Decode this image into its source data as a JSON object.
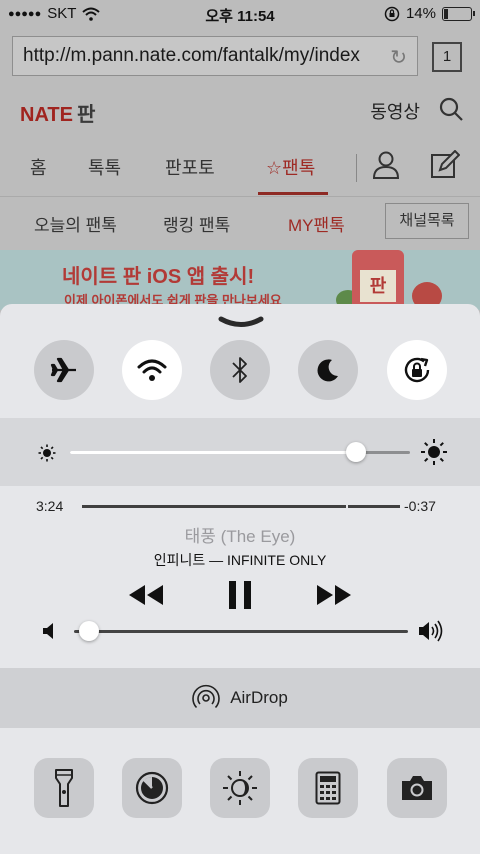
{
  "status_bar": {
    "signal_dots": "●●●●●",
    "carrier": "SKT",
    "time": "오후 11:54",
    "battery_percent": "14%",
    "battery_level": 0.14
  },
  "browser": {
    "url": "http://m.pann.nate.com/fantalk/my/index",
    "tab_count": "1"
  },
  "site": {
    "logo": "NATE",
    "logo_suffix": "판",
    "video_link": "동영상",
    "nav_main": [
      "홈",
      "톡톡",
      "판포토",
      "☆팬톡"
    ],
    "nav_sub": [
      "오늘의 팬톡",
      "랭킹 팬톡",
      "MY팬톡"
    ],
    "channel_button": "채널목록",
    "banner_title": "네이트 판 iOS 앱 출시!",
    "banner_subtitle": "이제 아이폰에서도 쉽게 판을 만나보세요",
    "banner_phone_text": "판"
  },
  "control_center": {
    "toggles": [
      {
        "name": "airplane-mode",
        "icon": "airplane-icon",
        "on": false
      },
      {
        "name": "wifi",
        "icon": "wifi-icon",
        "on": true
      },
      {
        "name": "bluetooth",
        "icon": "bluetooth-icon",
        "on": false
      },
      {
        "name": "do-not-disturb",
        "icon": "moon-icon",
        "on": false
      },
      {
        "name": "rotation-lock",
        "icon": "rotation-lock-icon",
        "on": true
      }
    ],
    "brightness": 0.84,
    "music": {
      "elapsed": "3:24",
      "remaining": "-0:37",
      "progress": 0.83,
      "title": "태풍 (The Eye)",
      "artist_album": "인피니트 — INFINITE ONLY",
      "volume": 0.02
    },
    "airdrop_label": "AirDrop",
    "shortcuts": [
      "flashlight-icon",
      "timer-icon",
      "night-shift-icon",
      "calculator-icon",
      "camera-icon"
    ]
  },
  "colors": {
    "nate_red": "#a0241f",
    "cc_background": "#e6e7ea",
    "toggle_on": "#ffffff",
    "toggle_off": "#c9cacd"
  }
}
